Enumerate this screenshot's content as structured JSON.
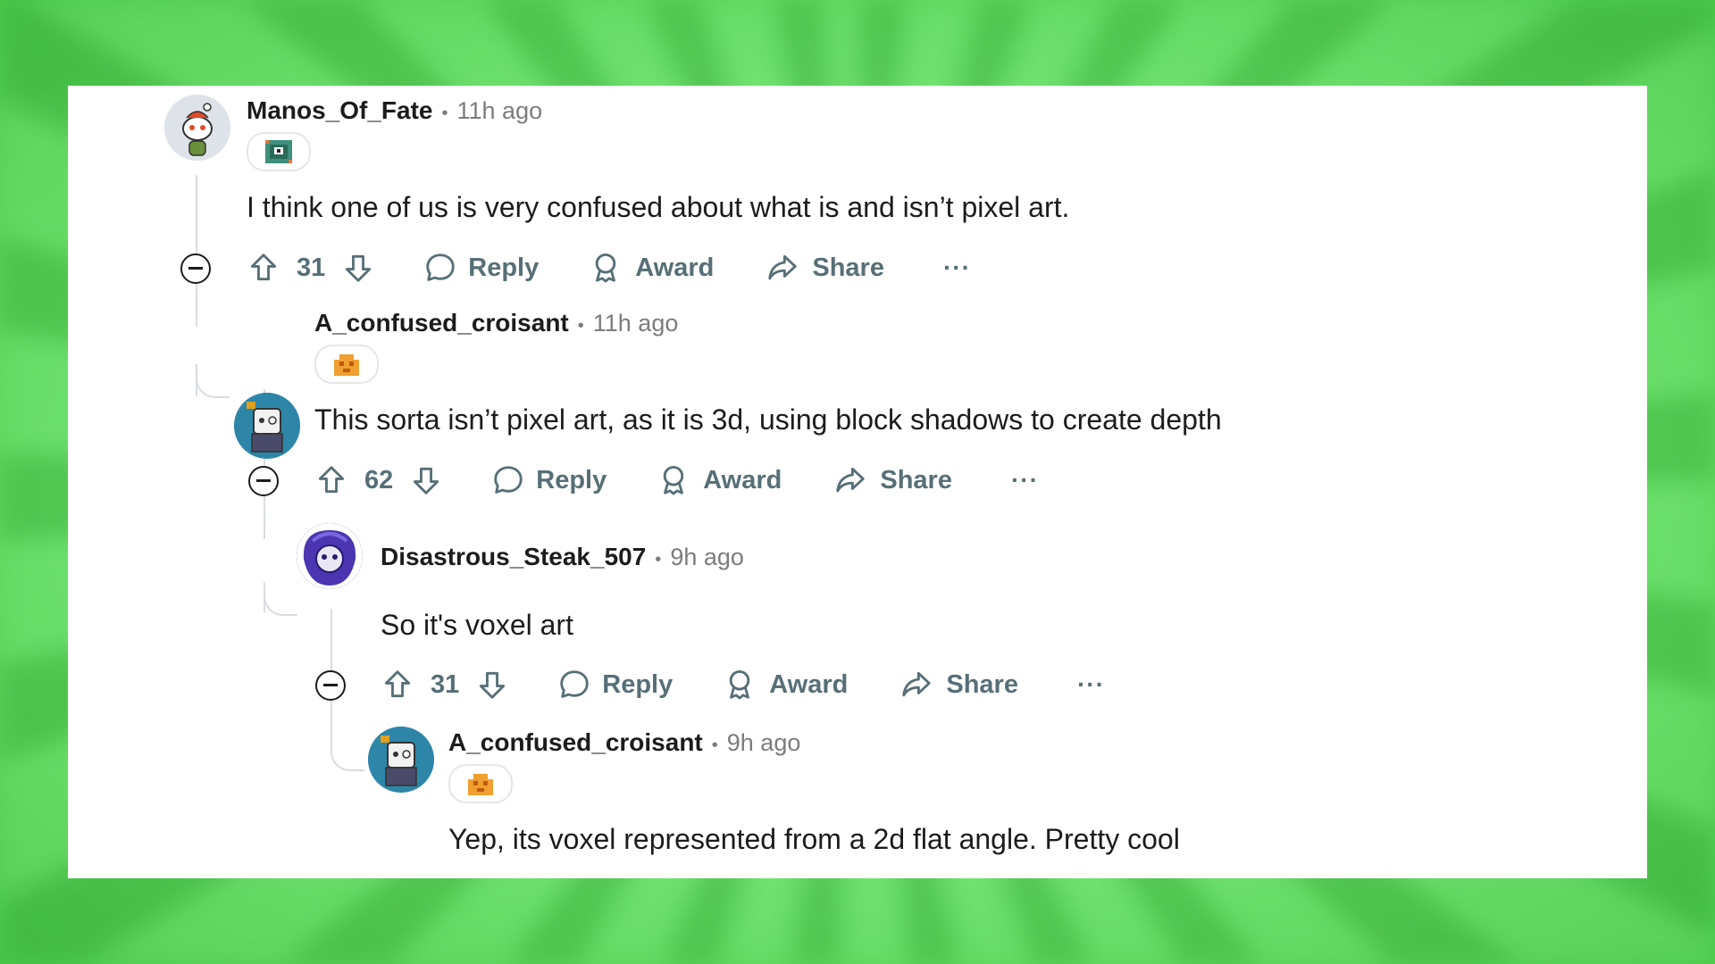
{
  "comments": [
    {
      "author": "Manos_Of_Fate",
      "time": "11h ago",
      "body": "I think one of us is very confused about what is and isn’t pixel art.",
      "score": "31",
      "reply_label": "Reply",
      "award_label": "Award",
      "share_label": "Share",
      "more_label": "···"
    },
    {
      "author": "A_confused_croisant",
      "time": "11h ago",
      "body": "This sorta isn’t pixel art, as it is 3d, using block shadows to create depth",
      "score": "62",
      "reply_label": "Reply",
      "award_label": "Award",
      "share_label": "Share",
      "more_label": "···"
    },
    {
      "author": "Disastrous_Steak_507",
      "time": "9h ago",
      "body": "So it's voxel art",
      "score": "31",
      "reply_label": "Reply",
      "award_label": "Award",
      "share_label": "Share",
      "more_label": "···"
    },
    {
      "author": "A_confused_croisant",
      "time": "9h ago",
      "body": "Yep, its voxel represented from a 2d flat angle. Pretty cool"
    }
  ],
  "separator": "•",
  "colors": {
    "background": "#6fe36f",
    "card": "#ffffff",
    "text": "#1c1c1c",
    "muted": "#7c7c7c",
    "action": "#576f76",
    "thread_line": "#d9dde1"
  },
  "icons": {
    "upvote": "arrow-up-icon",
    "downvote": "arrow-down-icon",
    "reply": "speech-bubble-icon",
    "award": "award-ribbon-icon",
    "share": "share-arrow-icon",
    "collapse": "minus-circle-icon"
  }
}
